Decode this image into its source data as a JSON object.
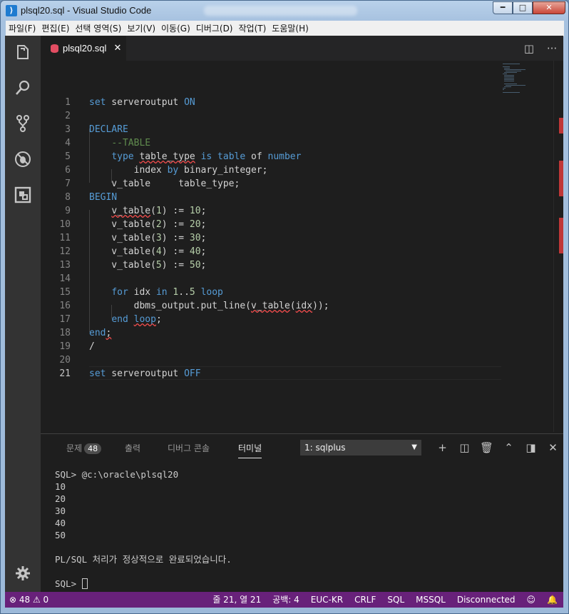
{
  "window": {
    "title": "plsql20.sql - Visual Studio Code",
    "icon": "vscode-icon",
    "min_label": "━",
    "max_label": "□",
    "close_label": "✕"
  },
  "menu": [
    "파일(F)",
    "편집(E)",
    "선택 영역(S)",
    "보기(V)",
    "이동(G)",
    "디버그(D)",
    "작업(T)",
    "도움말(H)"
  ],
  "activity_bar": [
    "explorer-icon",
    "search-icon",
    "source-control-icon",
    "debug-icon",
    "extensions-icon",
    "settings-gear-icon"
  ],
  "tab": {
    "label": "plsql20.sql",
    "close": "✕"
  },
  "tab_actions": {
    "split": "◫",
    "more": "···"
  },
  "editor": {
    "line_numbers": [
      "1",
      "2",
      "3",
      "4",
      "5",
      "6",
      "7",
      "8",
      "9",
      "10",
      "11",
      "12",
      "13",
      "14",
      "15",
      "16",
      "17",
      "18",
      "19",
      "20",
      "21"
    ],
    "active_line": 21
  },
  "panel": {
    "tabs": {
      "problems": "문제",
      "problems_count": "48",
      "output": "출력",
      "debug_console": "디버그 콘솔",
      "terminal": "터미널"
    },
    "terminal_select": "1: sqlplus",
    "actions": {
      "add": "+",
      "split": "◫",
      "kill": "🗑",
      "maximize": "⌃",
      "toggle": "◨",
      "close": "✕"
    },
    "terminal_lines": [
      "SQL> @c:\\oracle\\plsql20",
      "10",
      "20",
      "30",
      "40",
      "50",
      "",
      "PL/SQL 처리가 정상적으로 완료되었습니다.",
      ""
    ],
    "prompt": "SQL> "
  },
  "status": {
    "errors": "⊗ 48",
    "warnings": "⚠ 0",
    "position": "줄 21, 열 21",
    "spaces": "공백: 4",
    "encoding": "EUC-KR",
    "eol": "CRLF",
    "language": "SQL",
    "dialect": "MSSQL",
    "connection": "Disconnected",
    "feedback": "☺",
    "bell": "🔔"
  },
  "colors": {
    "statusbar": "#68217a",
    "keyword": "#569cd6",
    "comment": "#608b4e",
    "number": "#b5cea8",
    "error_squiggle": "#f14c4c"
  }
}
